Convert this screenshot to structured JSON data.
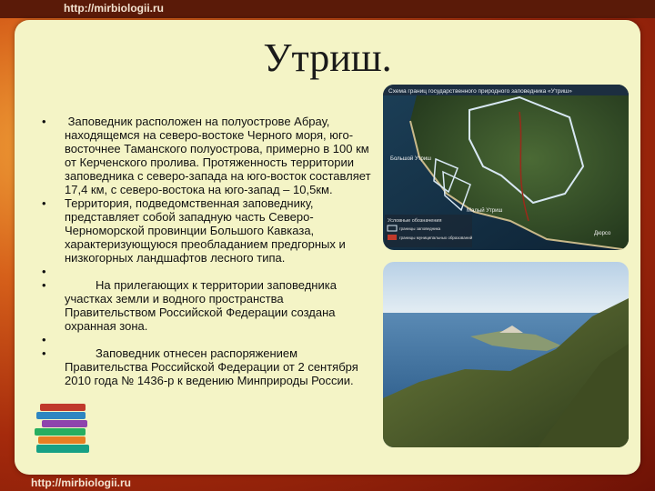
{
  "site_url": "http://mirbiologii.ru",
  "slide": {
    "title": "Утриш.",
    "bullets": [
      "Заповедник расположен на полуострове Абрау, находящемся на северо-востоке Черного моря, юго-восточнее Таманского полуострова, примерно в 100 км от Керченского пролива. Протяженность территории заповедника с северо-запада на юго-восток составляет 17,4 км, с северо-востока на юго-запад – 10,5км.",
      "Территория, подведомственная заповеднику, представляет собой западную часть Северо-Черноморской провинции Большого Кавказа, характеризующуюся преобладанием предгорных и низкогорных ландшафтов лесного типа.",
      "На прилегающих к территории заповедника участках земли и водного пространства Правительством Российской Федерации создана охранная зона.",
      "Заповедник отнесен распоряжением Правительства Российской Федерации от 2 сентября 2010 года № 1436-р к ведению Минприроды России."
    ]
  },
  "map": {
    "title": "Схема границ государственного природного заповедника «Утриш»",
    "place_bolshoy": "Большой Утриш",
    "place_maly": "Малый Утриш",
    "place_dyurso": "Дюрсо",
    "legend_heading": "Условные обозначения",
    "legend_1": "границы заповедника",
    "legend_2": "границы муниципальных образований"
  },
  "colors": {
    "frame": "#a52a0c",
    "panel": "#f4f4c6"
  }
}
